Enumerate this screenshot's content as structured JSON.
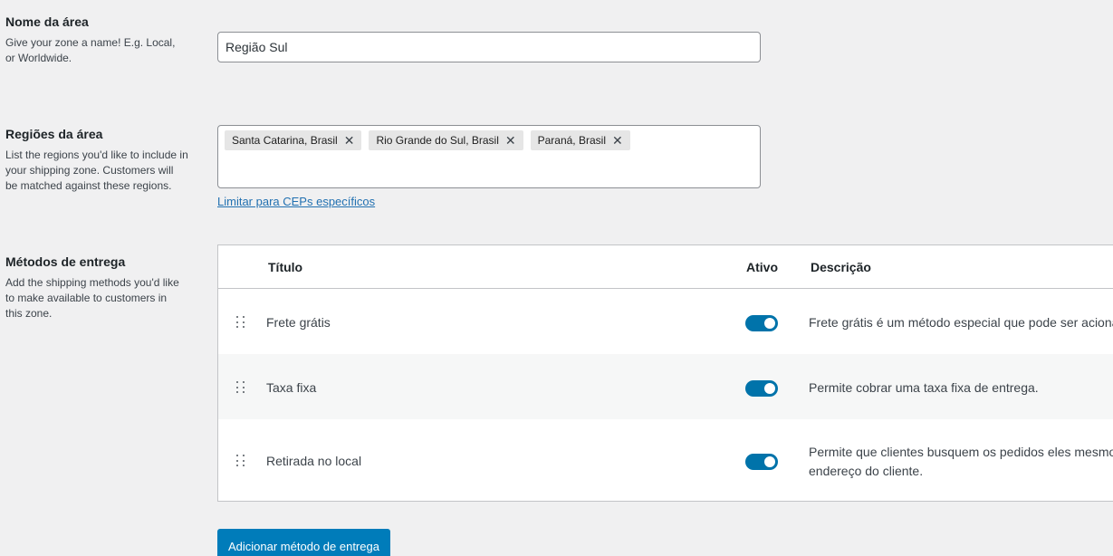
{
  "zone_name": {
    "title": "Nome da área",
    "description": "Give your zone a name! E.g. Local, or Worldwide.",
    "value": "Região Sul"
  },
  "zone_regions": {
    "title": "Regiões da área",
    "description": "List the regions you'd like to include in your shipping zone. Customers will be matched against these regions.",
    "chips": [
      "Santa Catarina, Brasil",
      "Rio Grande do Sul, Brasil",
      "Paraná, Brasil"
    ],
    "remove_glyph": "✕",
    "limit_link": "Limitar para CEPs específicos"
  },
  "shipping_methods": {
    "title": "Métodos de entrega",
    "description": "Add the shipping methods you'd like to make available to customers in this zone.",
    "columns": {
      "title": "Título",
      "active": "Ativo",
      "description": "Descrição"
    },
    "rows": [
      {
        "title": "Frete grátis",
        "enabled": true,
        "description": "Frete grátis é um método especial que pode ser acionado com cupons e mínimos de compra."
      },
      {
        "title": "Taxa fixa",
        "enabled": true,
        "description": "Permite cobrar uma taxa fixa de entrega."
      },
      {
        "title": "Retirada no local",
        "enabled": true,
        "description": "Permite que clientes busquem os pedidos eles mesmos. Por padrão, quando usam a retirada local, a taxa é calculada a partir do",
        "description_line2": "endereço do cliente."
      }
    ],
    "add_button": "Adicionar método de entrega"
  },
  "colors": {
    "accent": "#007cba",
    "toggle_on": "#0073aa",
    "link": "#2271b1",
    "background": "#f0f0f1"
  }
}
